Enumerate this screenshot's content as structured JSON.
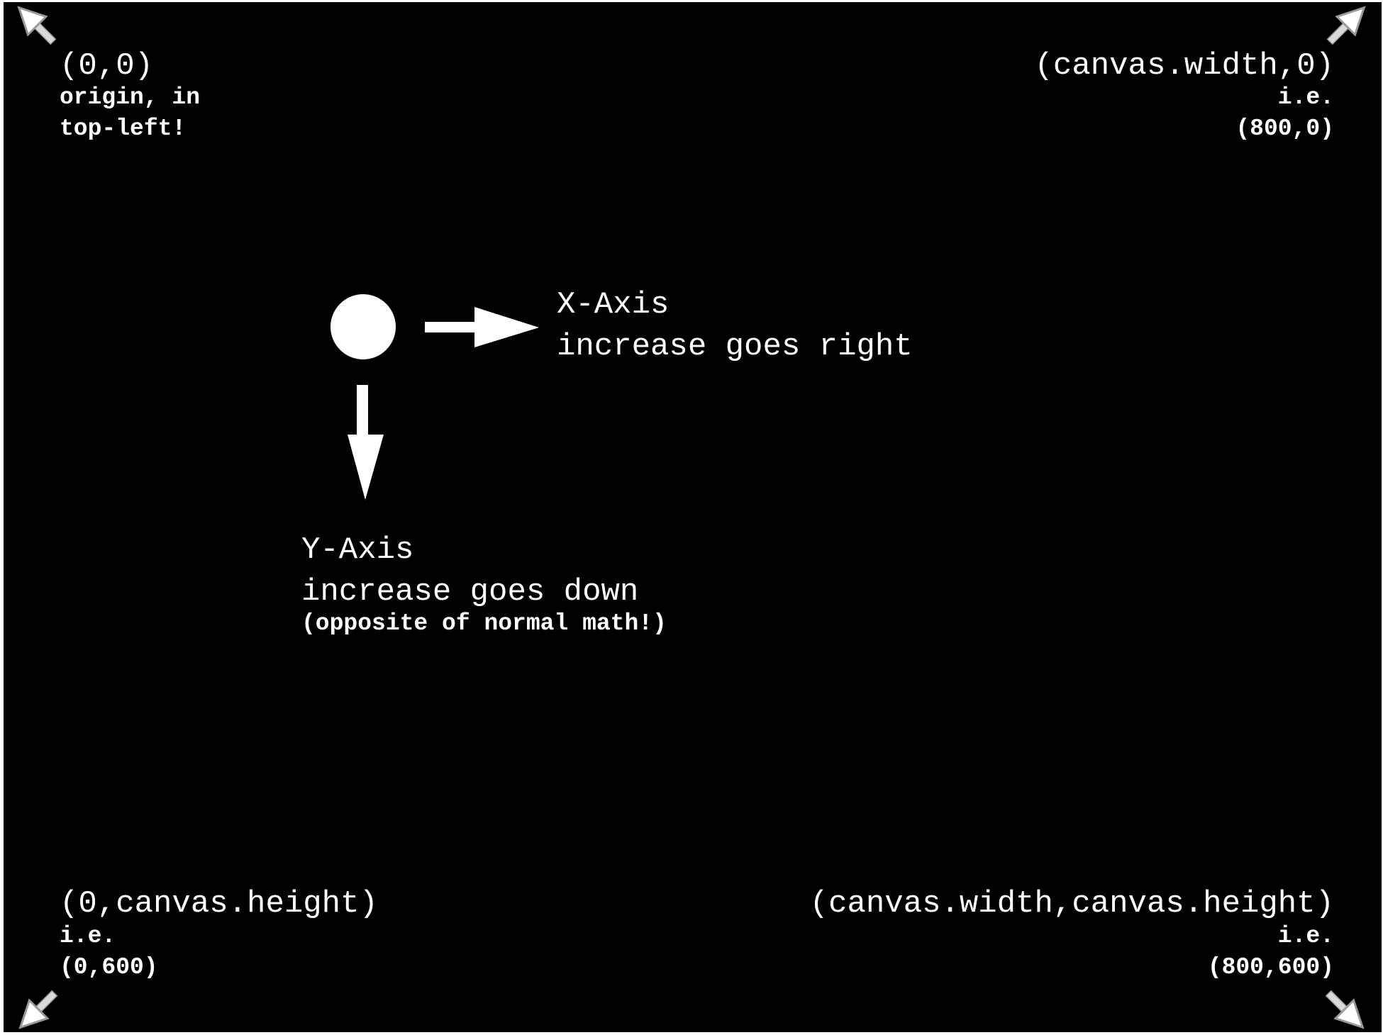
{
  "corners": {
    "top_left": {
      "coords": "(0,0)",
      "note_line1": "origin, in",
      "note_line2": "top-left!"
    },
    "top_right": {
      "coords": "(canvas.width,0)",
      "note_line1": "i.e.",
      "note_line2": "(800,0)"
    },
    "bottom_left": {
      "coords": "(0,canvas.height)",
      "note_line1": "i.e.",
      "note_line2": "(0,600)"
    },
    "bottom_right": {
      "coords": "(canvas.width,canvas.height)",
      "note_line1": "i.e.",
      "note_line2": "(800,600)"
    }
  },
  "x_axis": {
    "title": "X-Axis",
    "desc": "increase goes right"
  },
  "y_axis": {
    "title": "Y-Axis",
    "desc": "increase goes down",
    "note": "(opposite of normal math!)"
  },
  "colors": {
    "background": "#000000",
    "foreground": "#ffffff",
    "corner_arrow_fill": "#d9d9d9"
  }
}
